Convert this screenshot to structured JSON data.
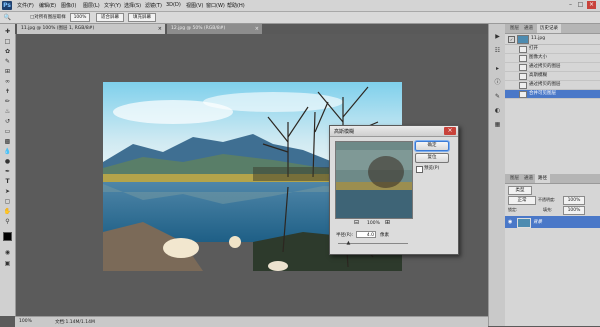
{
  "app": {
    "logo": "Ps"
  },
  "menu": [
    "文件(F)",
    "编辑(E)",
    "图像(I)",
    "图层(L)",
    "文字(Y)",
    "选择(S)",
    "滤镜(T)",
    "3D(D)",
    "视图(V)",
    "窗口(W)",
    "帮助(H)"
  ],
  "window_controls": {
    "minimize": "–",
    "restore": "□",
    "close": "×"
  },
  "options": {
    "sample_all_layers": "□对所有图层取样",
    "zoom_value": "100%",
    "btn_fit_screen": "适合屏幕",
    "btn_fill_screen": "填充屏幕"
  },
  "tabs": [
    {
      "label": "11.jpg @ 100% (图层 1, RGB/8#)",
      "close": "×"
    },
    {
      "label": "12.jpg @ 50% (RGB/8#)",
      "close": "×"
    }
  ],
  "status": {
    "zoom": "100%",
    "doc": "文档:1.14M/1.14M"
  },
  "panels": {
    "top_tabs": [
      "图层",
      "通道",
      "历史记录"
    ],
    "history": {
      "snapshot": "11.jpg",
      "items": [
        {
          "label": "打开",
          "selected": false
        },
        {
          "label": "图像大小",
          "selected": false
        },
        {
          "label": "通过拷贝的图层",
          "selected": false
        },
        {
          "label": "高斯模糊",
          "selected": false
        },
        {
          "label": "通过拷贝的图层",
          "selected": false
        },
        {
          "label": "合并可见图层",
          "selected": true
        }
      ]
    },
    "layers_tabs": [
      "图层",
      "通道",
      "路径"
    ],
    "layers_kind": "类型",
    "layers_mode": "正常",
    "layers_opacity_label": "不透明度:",
    "layers_opacity": "100%",
    "layers_lock_label": "锁定:",
    "layers_fill_label": "填充:",
    "layers_fill": "100%",
    "layer_name": "背景"
  },
  "dialog": {
    "title": "高斯模糊",
    "ok": "确定",
    "cancel": "复位",
    "preview_label": "预览(P)",
    "zoom": "100%",
    "radius_label": "半径(R):",
    "radius_value": "4.0",
    "radius_unit": "像素",
    "radius_fraction": 0.15,
    "close": "×"
  },
  "colors": {
    "accent_selected": "#4a78c8",
    "dialog_close": "#c8423a"
  }
}
